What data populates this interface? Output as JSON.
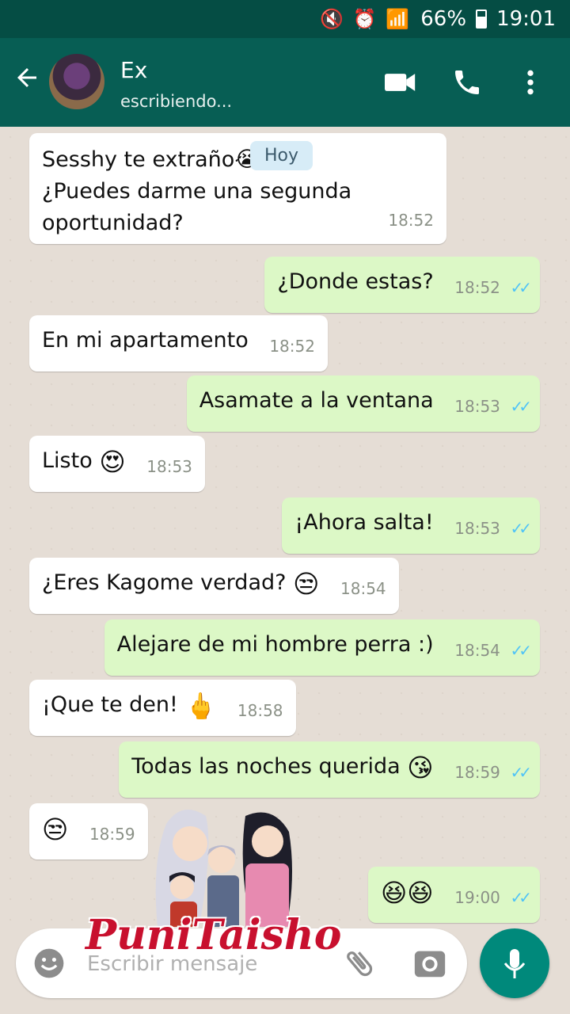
{
  "status_bar": {
    "icons": "🔇 ⏰ 📶",
    "battery": "66%",
    "time": "19:01"
  },
  "app_bar": {
    "contact_name": "Ex",
    "contact_status": "escribiendo..."
  },
  "date_chip": "Hoy",
  "messages": [
    {
      "dir": "in",
      "lines": [
        "Sesshy te extraño😭😭",
        "¿Puedes darme una segunda",
        "oportunidad?"
      ],
      "time": "18:52"
    },
    {
      "dir": "out",
      "text": "¿Donde estas?",
      "time": "18:52"
    },
    {
      "dir": "in",
      "text": "En mi apartamento",
      "time": "18:52"
    },
    {
      "dir": "out",
      "text": "Asamate a la ventana",
      "time": "18:53"
    },
    {
      "dir": "in",
      "text": "Listo",
      "emoji": "😍",
      "time": "18:53"
    },
    {
      "dir": "out",
      "text": "¡Ahora salta!",
      "time": "18:53"
    },
    {
      "dir": "in",
      "text": "¿Eres Kagome verdad?",
      "emoji": "😒",
      "time": "18:54"
    },
    {
      "dir": "out",
      "text": "Alejare de mi hombre perra :)",
      "time": "18:54"
    },
    {
      "dir": "in",
      "text": "¡Que te den!",
      "emoji": "🖕",
      "time": "18:58"
    },
    {
      "dir": "out",
      "text": "Todas las noches querida",
      "emoji": "😘",
      "time": "18:59"
    },
    {
      "dir": "in",
      "text": "",
      "emoji": "😒",
      "time": "18:59"
    },
    {
      "dir": "out",
      "text": "",
      "emoji": "😆😆",
      "time": "19:00"
    }
  ],
  "ticks": "✓✓",
  "input": {
    "placeholder": "Escribir mensaje"
  },
  "watermark": "PuniTaisho",
  "colors": {
    "header": "#075e54",
    "status_bar": "#054d44",
    "outgoing_bubble": "#dcf8c6",
    "incoming_bubble": "#ffffff",
    "read_ticks": "#4fc3f7",
    "mic_button": "#00897b"
  },
  "icons": [
    "back-arrow-icon",
    "video-call-icon",
    "phone-icon",
    "more-vert-icon",
    "emoji-icon",
    "attach-icon",
    "camera-icon",
    "mic-icon"
  ]
}
